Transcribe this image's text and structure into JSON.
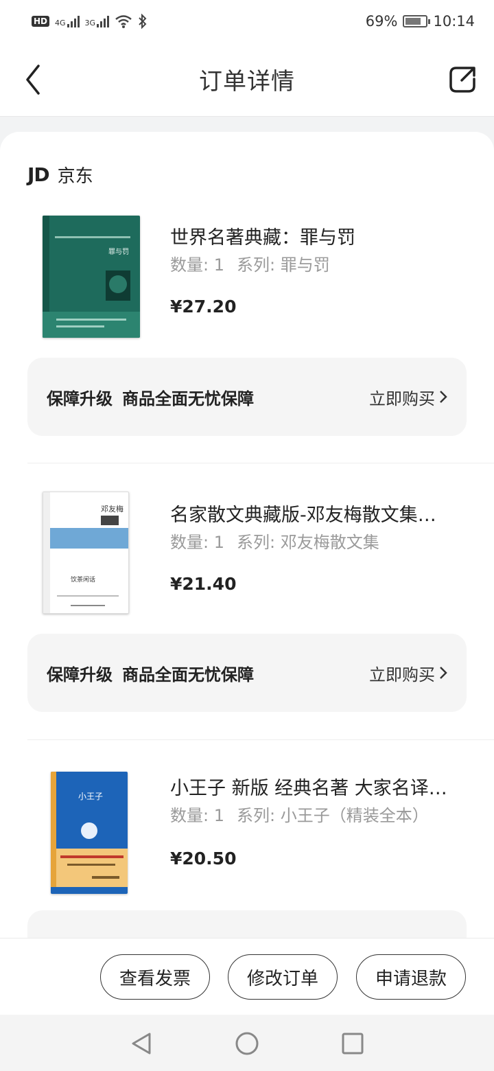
{
  "status_bar": {
    "hd": "HD",
    "net1": "4G",
    "net2": "3G",
    "battery_pct": "69%",
    "time": "10:14",
    "icons": [
      "signal-icon",
      "wifi-icon",
      "bluetooth-icon",
      "battery-icon"
    ]
  },
  "header": {
    "title": "订单详情",
    "back_icon": "back-chevron-icon",
    "share_icon": "share-icon"
  },
  "store": {
    "logo": "JD",
    "name": "京东"
  },
  "items": [
    {
      "title": "世界名著典藏：罪与罚",
      "qty_label": "数量: 1",
      "series_label": "系列: 罪与罚",
      "price": "¥27.20",
      "cover_color": "#1e6b5c",
      "cover_title": "罪与罚"
    },
    {
      "title": "名家散文典藏版-邓友梅散文集…",
      "qty_label": "数量: 1",
      "series_label": "系列: 邓友梅散文集",
      "price": "¥21.40",
      "cover_color": "#ffffff",
      "cover_title": "邓友梅"
    },
    {
      "title": "小王子 新版 经典名著 大家名译…",
      "qty_label": "数量: 1",
      "series_label": "系列: 小王子（精装全本）",
      "price": "¥20.50",
      "cover_color": "#1d64b8",
      "cover_title": "小王子"
    }
  ],
  "guarantee": {
    "label": "保障升级",
    "desc": "商品全面无忧保障",
    "action": "立即购买"
  },
  "bottom_actions": {
    "invoice": "查看发票",
    "modify": "修改订单",
    "refund": "申请退款"
  },
  "nav": {
    "icons": [
      "nav-back-icon",
      "nav-home-icon",
      "nav-recents-icon"
    ]
  }
}
